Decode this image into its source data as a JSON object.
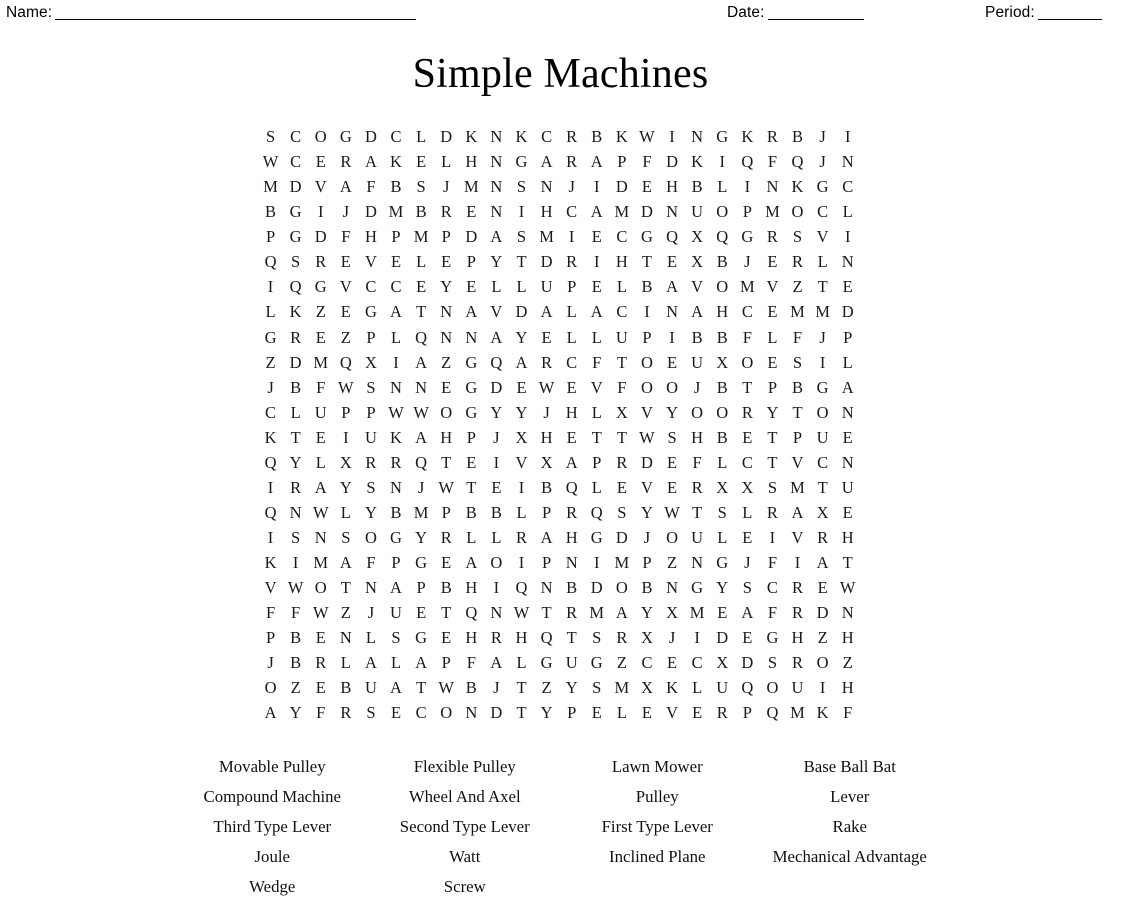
{
  "header": {
    "name_label": "Name:",
    "name_rule": "_____________________________________________",
    "date_label": "Date:",
    "date_rule": "____________",
    "period_label": "Period:",
    "period_rule": "________"
  },
  "title": "Simple Machines",
  "puzzle": {
    "rows": 24,
    "cols": 24,
    "grid": [
      "SCOGDCLDKNKCRBKWINGKRBJI",
      "WCERAKELHNGARAPFDKIQFQJN",
      "MDVAFBSJMNSNJIDEHBLINKGC",
      "BGIJDMBRENIHCAMDNUOPMOCL",
      "PGDFHPMPDASMIECGQXQGRSVI",
      "QSREVELEPYTDRIHTEXBJERLN",
      "IQGVCCEYELLUPELBAVOMVZTE",
      "LKZEGATNAVDALACINAHCEMMD",
      "GREZPLQNNAYELLUPIBBFLFJP",
      "ZDMQXIAZGQARCFTOEUXOESIL",
      "JBFWSNNEGDEWEVFOOJBTPBGA",
      "CLUPPWWOGYYJHLXVYOORYTON",
      "KTEIUKAHPJXHETTWSHBETPUE",
      "QYLXRRQTEIVXAPRDEFLCTVCN",
      "IRAYSNJWTEIBQLEVERXXSMTU",
      "QNWLYBMPBBLPRQSYWTSLRAXE",
      "ISNSOGYRLLRAHGDJOULEIVRH",
      "KIMAFPGEAOIPNIMPZNGJFIAT",
      "VWOTNAPBHIQNBDOBNGYSCREW",
      "FFWZJUETQNWTRMAYXMEAFRDN",
      "PBENLSGEHRHQTSRXJIDEGHZH",
      "JBRLALAPFALGUGZCECXDSROZ",
      "OZEBUATWBJTZYSMXKLUQOUIH",
      "AYFRSECONDTYPELEVERPQMKF"
    ]
  },
  "wordlist": {
    "words": [
      "Movable Pulley",
      "Flexible Pulley",
      "Lawn Mower",
      "Base Ball Bat",
      "Compound Machine",
      "Wheel And Axel",
      "Pulley",
      "Lever",
      "Third Type Lever",
      "Second Type Lever",
      "First Type Lever",
      "Rake",
      "Joule",
      "Watt",
      "Inclined Plane",
      "Mechanical Advantage",
      "Wedge",
      "Screw",
      "",
      ""
    ]
  }
}
